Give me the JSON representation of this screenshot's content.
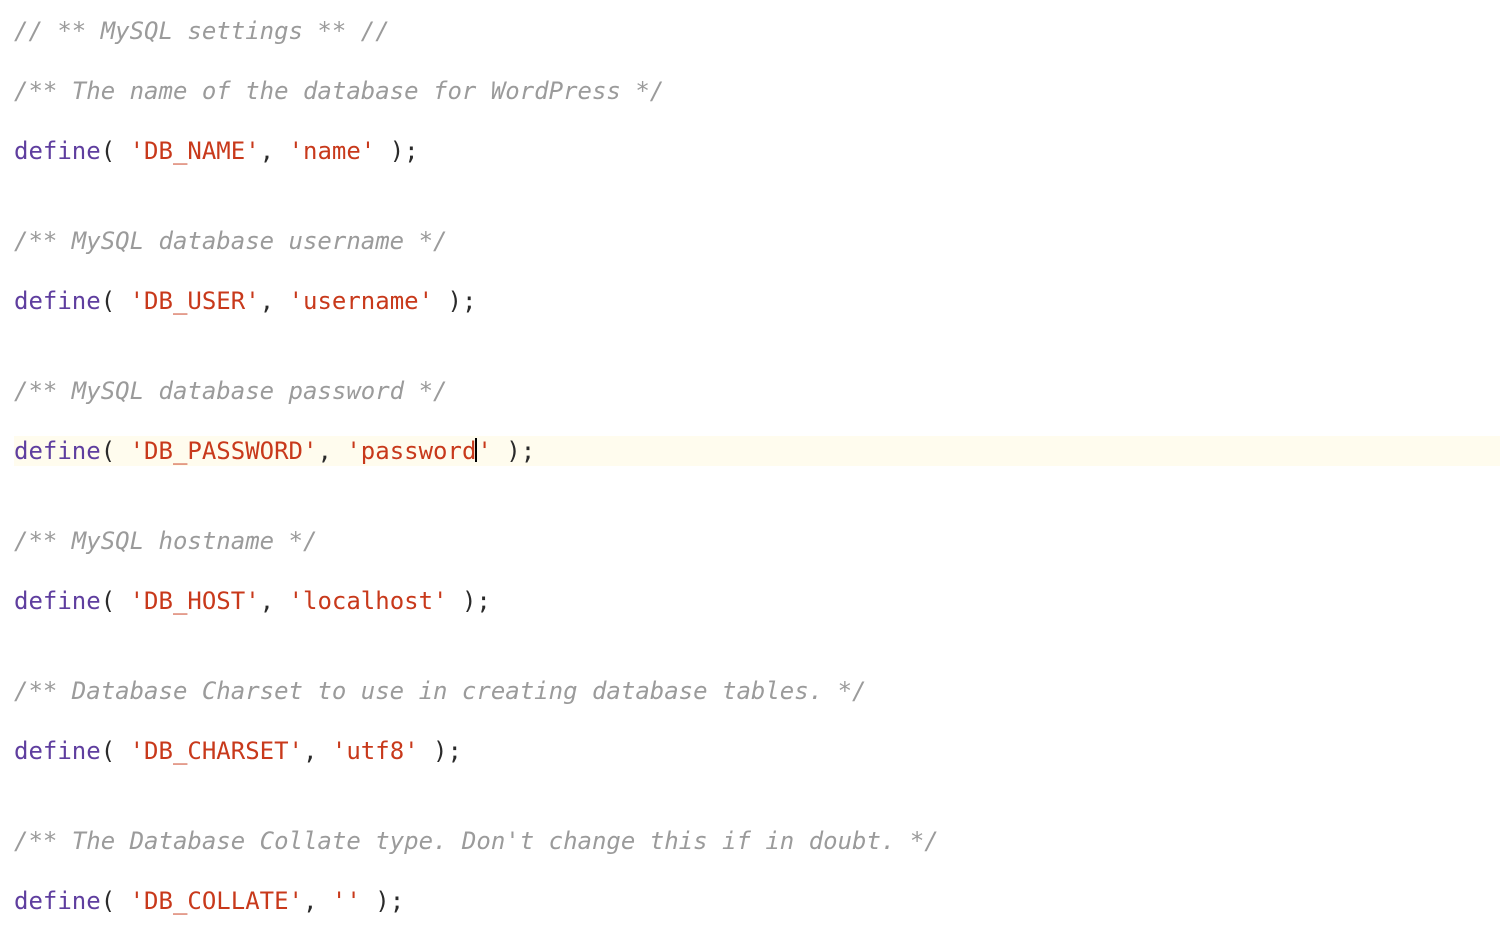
{
  "code": {
    "lines": [
      {
        "id": "l1",
        "hl": false,
        "tokens": [
          {
            "cls": "tok-comment",
            "t": "// ** MySQL settings ** //"
          }
        ]
      },
      {
        "id": "l2",
        "hl": false,
        "tokens": [
          {
            "cls": "tok-comment",
            "t": "/** The name of the database for WordPress */"
          }
        ]
      },
      {
        "id": "l3",
        "hl": false,
        "tokens": [
          {
            "cls": "tok-func",
            "t": "define"
          },
          {
            "cls": "tok-punct",
            "t": "( "
          },
          {
            "cls": "tok-string",
            "t": "'DB_NAME'"
          },
          {
            "cls": "tok-punct",
            "t": ", "
          },
          {
            "cls": "tok-string",
            "t": "'name'"
          },
          {
            "cls": "tok-punct",
            "t": " );"
          }
        ]
      },
      {
        "id": "l4",
        "hl": false,
        "tokens": [
          {
            "cls": "",
            "t": ""
          }
        ]
      },
      {
        "id": "l5",
        "hl": false,
        "tokens": [
          {
            "cls": "tok-comment",
            "t": "/** MySQL database username */"
          }
        ]
      },
      {
        "id": "l6",
        "hl": false,
        "tokens": [
          {
            "cls": "tok-func",
            "t": "define"
          },
          {
            "cls": "tok-punct",
            "t": "( "
          },
          {
            "cls": "tok-string",
            "t": "'DB_USER'"
          },
          {
            "cls": "tok-punct",
            "t": ", "
          },
          {
            "cls": "tok-string",
            "t": "'username'"
          },
          {
            "cls": "tok-punct",
            "t": " );"
          }
        ]
      },
      {
        "id": "l7",
        "hl": false,
        "tokens": [
          {
            "cls": "",
            "t": ""
          }
        ]
      },
      {
        "id": "l8",
        "hl": false,
        "tokens": [
          {
            "cls": "tok-comment",
            "t": "/** MySQL database password */"
          }
        ]
      },
      {
        "id": "l9",
        "hl": true,
        "tokens": [
          {
            "cls": "tok-func",
            "t": "define"
          },
          {
            "cls": "tok-punct",
            "t": "( "
          },
          {
            "cls": "tok-string",
            "t": "'DB_PASSWORD'"
          },
          {
            "cls": "tok-punct",
            "t": ", "
          },
          {
            "cls": "tok-string",
            "t": "'password"
          },
          {
            "cls": "cursor",
            "t": ""
          },
          {
            "cls": "tok-string",
            "t": "'"
          },
          {
            "cls": "tok-punct",
            "t": " );"
          }
        ]
      },
      {
        "id": "l10",
        "hl": false,
        "tokens": [
          {
            "cls": "",
            "t": ""
          }
        ]
      },
      {
        "id": "l11",
        "hl": false,
        "tokens": [
          {
            "cls": "tok-comment",
            "t": "/** MySQL hostname */"
          }
        ]
      },
      {
        "id": "l12",
        "hl": false,
        "tokens": [
          {
            "cls": "tok-func",
            "t": "define"
          },
          {
            "cls": "tok-punct",
            "t": "( "
          },
          {
            "cls": "tok-string",
            "t": "'DB_HOST'"
          },
          {
            "cls": "tok-punct",
            "t": ", "
          },
          {
            "cls": "tok-string",
            "t": "'localhost'"
          },
          {
            "cls": "tok-punct",
            "t": " );"
          }
        ]
      },
      {
        "id": "l13",
        "hl": false,
        "tokens": [
          {
            "cls": "",
            "t": ""
          }
        ]
      },
      {
        "id": "l14",
        "hl": false,
        "tokens": [
          {
            "cls": "tok-comment",
            "t": "/** Database Charset to use in creating database tables. */"
          }
        ]
      },
      {
        "id": "l15",
        "hl": false,
        "tokens": [
          {
            "cls": "tok-func",
            "t": "define"
          },
          {
            "cls": "tok-punct",
            "t": "( "
          },
          {
            "cls": "tok-string",
            "t": "'DB_CHARSET'"
          },
          {
            "cls": "tok-punct",
            "t": ", "
          },
          {
            "cls": "tok-string",
            "t": "'utf8'"
          },
          {
            "cls": "tok-punct",
            "t": " );"
          }
        ]
      },
      {
        "id": "l16",
        "hl": false,
        "tokens": [
          {
            "cls": "",
            "t": ""
          }
        ]
      },
      {
        "id": "l17",
        "hl": false,
        "tokens": [
          {
            "cls": "tok-comment",
            "t": "/** The Database Collate type. Don't change this if in doubt. */"
          }
        ]
      },
      {
        "id": "l18",
        "hl": false,
        "tokens": [
          {
            "cls": "tok-func",
            "t": "define"
          },
          {
            "cls": "tok-punct",
            "t": "( "
          },
          {
            "cls": "tok-string",
            "t": "'DB_COLLATE'"
          },
          {
            "cls": "tok-punct",
            "t": ", "
          },
          {
            "cls": "tok-string",
            "t": "''"
          },
          {
            "cls": "tok-punct",
            "t": " );"
          }
        ]
      }
    ]
  }
}
